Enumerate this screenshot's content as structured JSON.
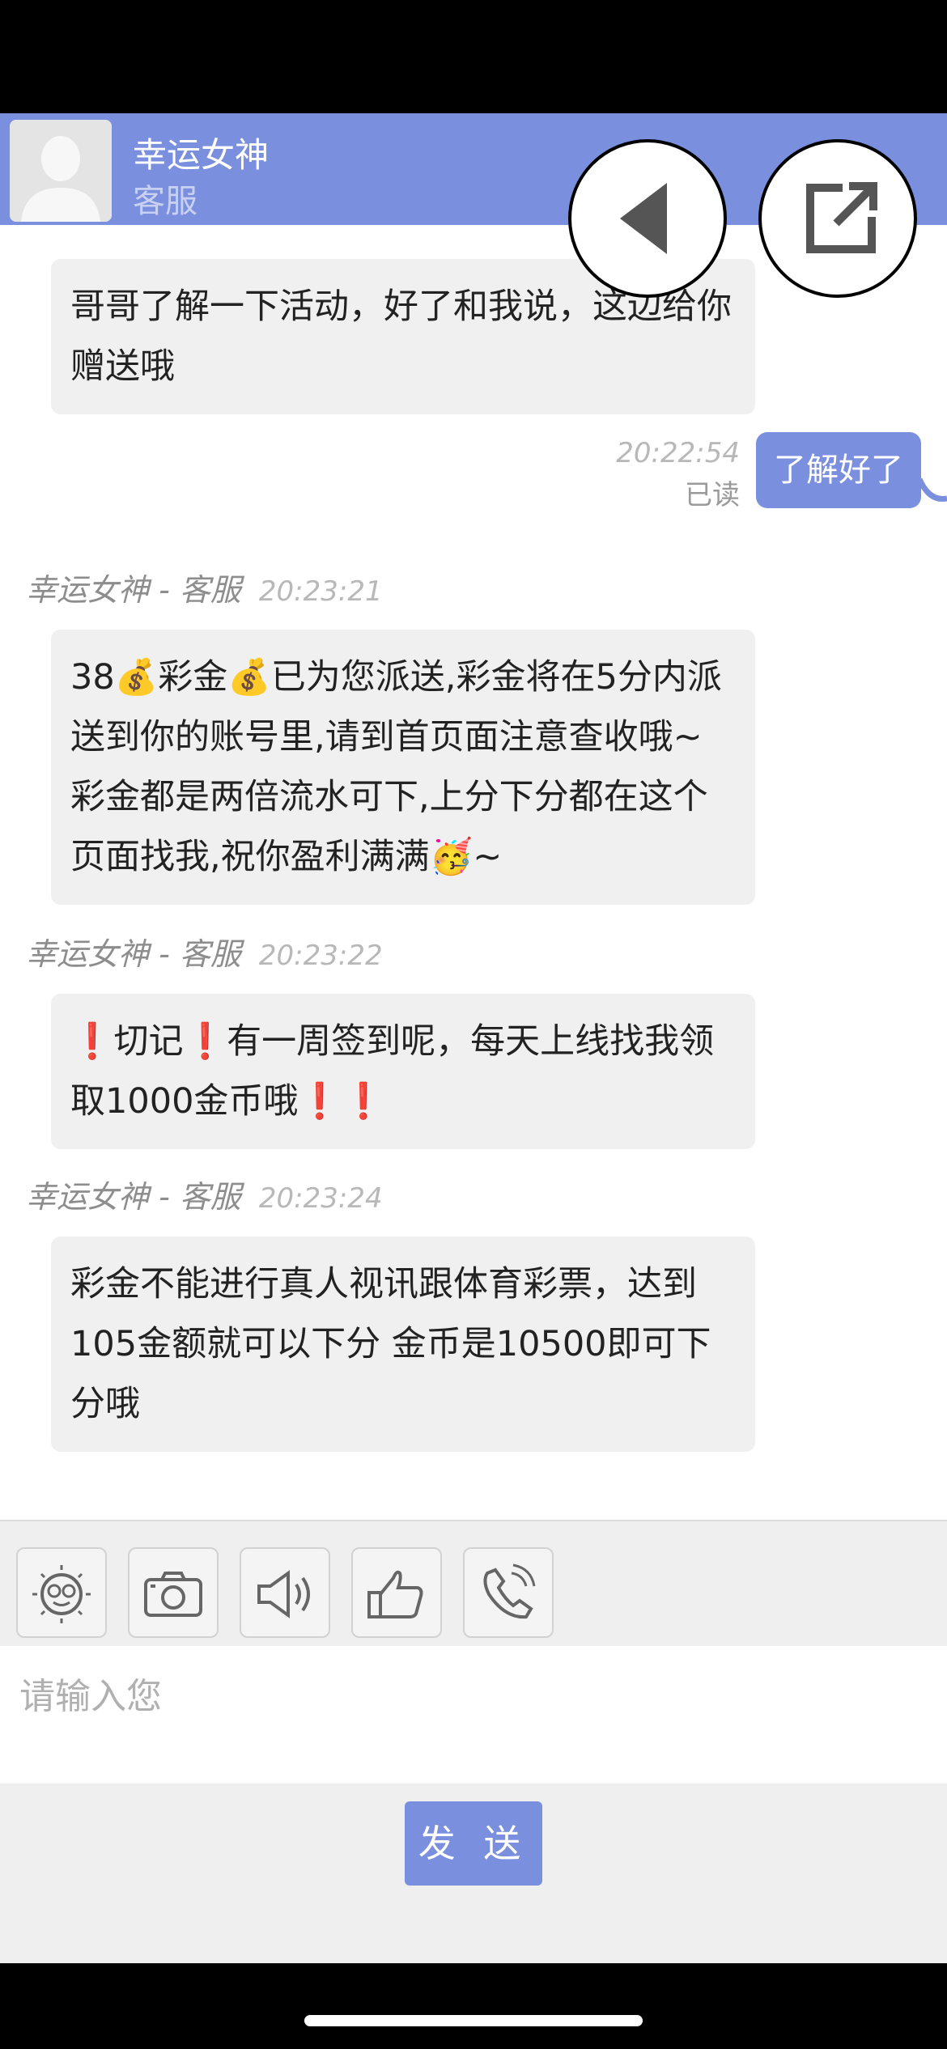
{
  "header": {
    "contact_name": "幸运女神",
    "contact_role": "客服"
  },
  "messages": [
    {
      "direction": "in",
      "text": "哥哥了解一下活动，好了和我说，这边给你赠送哦"
    },
    {
      "direction": "out",
      "time": "20:22:54",
      "status": "已读",
      "text": "了解好了"
    },
    {
      "direction": "in",
      "sender": "幸运女神 - 客服",
      "time": "20:23:21",
      "text": "38💰彩金💰已为您派送,彩金将在5分内派送到你的账号里,请到首页面注意查收哦~彩金都是两倍流水可下,上分下分都在这个页面找我,祝你盈利满满🥳~"
    },
    {
      "direction": "in",
      "sender": "幸运女神 - 客服",
      "time": "20:23:22",
      "text": "❗切记❗有一周签到呢，每天上线找我领取1000金币哦❗❗"
    },
    {
      "direction": "in",
      "sender": "幸运女神 - 客服",
      "time": "20:23:24",
      "text": "彩金不能进行真人视讯跟体育彩票，达到105金额就可以下分 金币是10500即可下分哦"
    }
  ],
  "toolbar": {
    "icons": [
      "emoji-icon",
      "camera-icon",
      "voice-icon",
      "thumbs-up-icon",
      "phone-icon"
    ]
  },
  "input": {
    "placeholder": "请输入您"
  },
  "send_label": "发 送",
  "colors": {
    "accent": "#7b8fdf",
    "bubble_in": "#f0f0f0",
    "toolbar_bg": "#efefef"
  }
}
